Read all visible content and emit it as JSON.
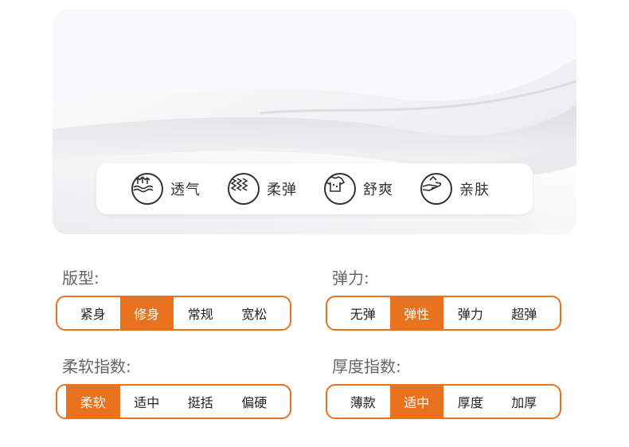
{
  "features": [
    {
      "icon": "breathable-icon",
      "label": "透气"
    },
    {
      "icon": "waves-icon",
      "label": "柔弹"
    },
    {
      "icon": "tshirt-icon",
      "label": "舒爽"
    },
    {
      "icon": "hand-icon",
      "label": "亲肤"
    }
  ],
  "groups": {
    "fit": {
      "title": "版型:",
      "options": [
        "紧身",
        "修身",
        "常规",
        "宽松"
      ],
      "selected": "修身"
    },
    "elasticity": {
      "title": "弹力:",
      "options": [
        "无弹",
        "弹性",
        "弹力",
        "超弹"
      ],
      "selected": "弹性"
    },
    "softness": {
      "title": "柔软指数:",
      "options": [
        "柔软",
        "适中",
        "挺括",
        "偏硬"
      ],
      "selected": "柔软"
    },
    "thickness": {
      "title": "厚度指数:",
      "options": [
        "薄款",
        "适中",
        "厚度",
        "加厚"
      ],
      "selected": "适中"
    }
  },
  "colors": {
    "accent": "#e8731e"
  }
}
